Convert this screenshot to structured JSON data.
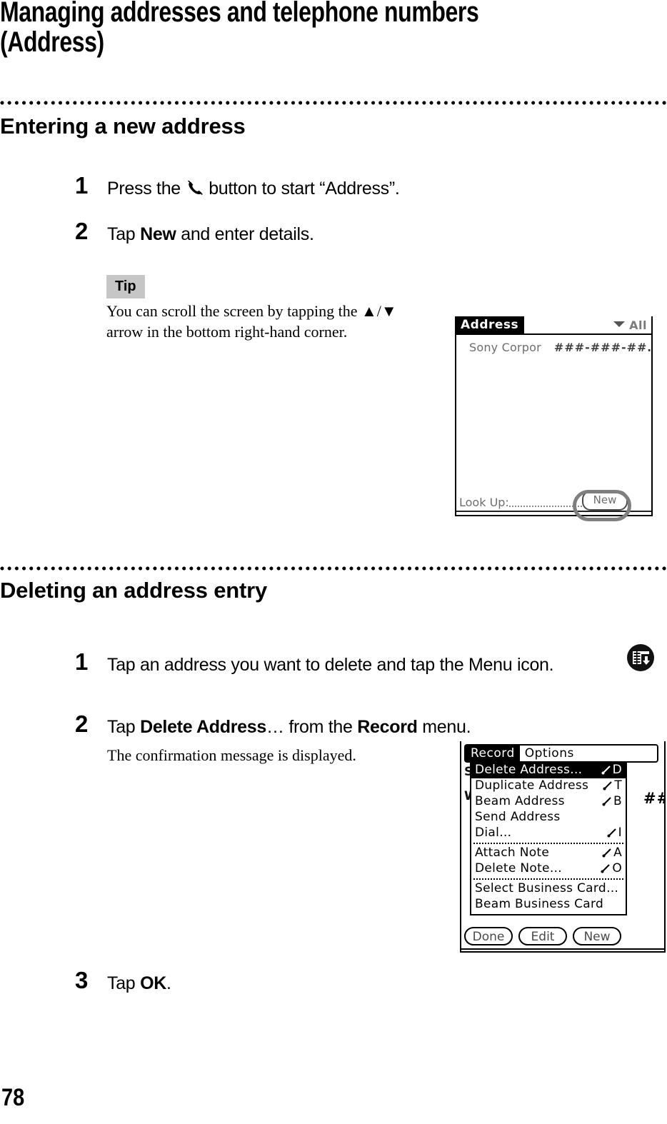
{
  "page": {
    "title": "Managing addresses and telephone numbers\n(Address)",
    "number": "78"
  },
  "sections": [
    {
      "heading": "Entering a new address",
      "steps": [
        {
          "num": "1",
          "text_before": "Press the ",
          "icon": "phone-handset-icon",
          "text_after": " button to start “Address”."
        },
        {
          "num": "2",
          "text_before": "Tap ",
          "bold": "New",
          "text_after": " and enter details."
        }
      ],
      "tip": {
        "label": "Tip",
        "body": "You can scroll the screen by tapping the ▲/▼ arrow in the bottom right-hand corner."
      }
    },
    {
      "heading": "Deleting an address entry",
      "steps": [
        {
          "num": "1",
          "text": "Tap an address you want to delete and tap the Menu icon.",
          "icon": "menu-icon"
        },
        {
          "num": "2",
          "text_before": "Tap ",
          "bold1": "Delete Address",
          "text_mid": "… from the ",
          "bold2": "Record",
          "text_after": " menu.",
          "note": "The confirmation message is displayed."
        },
        {
          "num": "3",
          "text_before": "Tap ",
          "bold": "OK",
          "text_after": "."
        }
      ]
    }
  ],
  "pda_address_screen": {
    "app_tab": "Address",
    "category": "All",
    "category_caret_icon": "triangle-down-icon",
    "record": {
      "name": "Sony Corpor",
      "phone": "###-###-##…W"
    },
    "lookup_label": "Look Up:",
    "new_button": "New"
  },
  "pda_menu_screen": {
    "menubar": [
      {
        "label": "Record",
        "active": true
      },
      {
        "label": "Options",
        "active": false
      }
    ],
    "underlying_list": [
      "S",
      "W"
    ],
    "underlying_hash": "##",
    "menu_groups": [
      [
        {
          "label": "Delete Address…",
          "shortcut": "D",
          "selected": true
        },
        {
          "label": "Duplicate Address",
          "shortcut": "T",
          "selected": false
        },
        {
          "label": "Beam Address",
          "shortcut": "B",
          "selected": false
        },
        {
          "label": "Send Address",
          "shortcut": "",
          "selected": false
        },
        {
          "label": "Dial…",
          "shortcut": "I",
          "selected": false
        }
      ],
      [
        {
          "label": "Attach Note",
          "shortcut": "A",
          "selected": false
        },
        {
          "label": "Delete Note…",
          "shortcut": "O",
          "selected": false
        }
      ],
      [
        {
          "label": "Select Business Card…",
          "shortcut": "",
          "selected": false
        },
        {
          "label": "Beam Business Card",
          "shortcut": "",
          "selected": false
        }
      ]
    ],
    "buttons": [
      "Done",
      "Edit",
      "New"
    ]
  }
}
